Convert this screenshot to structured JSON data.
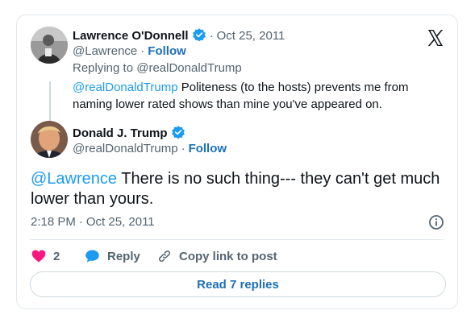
{
  "parent_tweet": {
    "author_name": "Lawrence O'Donnell",
    "author_handle": "@Lawrence",
    "date": "Oct 25, 2011",
    "follow_label": "Follow",
    "replying_to_prefix": "Replying to ",
    "replying_to_handle": "@realDonaldTrump",
    "text_mention": "@realDonaldTrump",
    "text_body": " Politeness (to the hosts) prevents me from naming lower rated shows than mine you've appeared on."
  },
  "main_tweet": {
    "author_name": "Donald J. Trump",
    "author_handle": "@realDonaldTrump",
    "follow_label": "Follow",
    "text_mention": "@Lawrence",
    "text_body": " There is no such thing--- they can't get much lower than yours.",
    "time": "2:18 PM",
    "date": "Oct 25, 2011"
  },
  "actions": {
    "like_count": "2",
    "reply_label": "Reply",
    "copy_link_label": "Copy link to post"
  },
  "read_replies_label": "Read 7 replies",
  "colors": {
    "accent": "#1d9bf0",
    "link": "#1d6fb8",
    "like": "#f91880",
    "muted": "#536471"
  },
  "icons": [
    "x-logo-icon",
    "verified-badge-icon",
    "heart-icon",
    "speech-bubble-icon",
    "link-icon",
    "info-icon"
  ]
}
